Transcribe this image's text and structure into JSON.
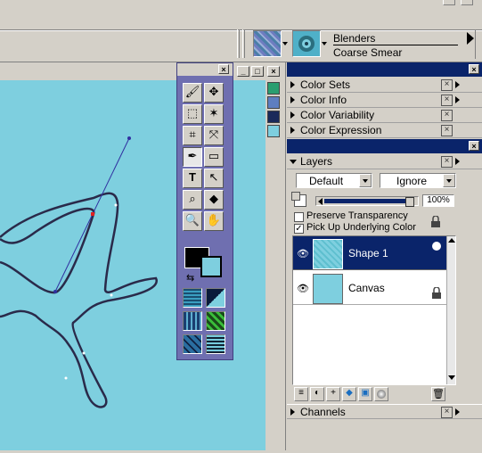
{
  "brush": {
    "category": "Blenders",
    "variant": "Coarse Smear"
  },
  "window_controls": {
    "close": "×",
    "minimize": "_",
    "maximize": "□"
  },
  "palette_sections": [
    {
      "label": "Color Sets"
    },
    {
      "label": "Color Info"
    },
    {
      "label": "Color Variability"
    },
    {
      "label": "Color Expression"
    }
  ],
  "layers_panel": {
    "title": "Layers",
    "composite_method": "Default",
    "composite_depth": "Ignore",
    "opacity": "100%",
    "opacity_value": 1.0,
    "preserve_transparency_label": "Preserve Transparency",
    "preserve_transparency_checked": false,
    "pick_up_color_label": "Pick Up Underlying Color",
    "pick_up_color_checked": true,
    "layers": [
      {
        "name": "Shape 1",
        "selected": true
      },
      {
        "name": "Canvas",
        "selected": false
      }
    ]
  },
  "channels_panel": {
    "title": "Channels"
  },
  "colors": {
    "canvas": "#7ecfdf",
    "title_bar": "#0a246a",
    "toolbox": "#6f6fb0",
    "selection": "#0a246a",
    "path": "#2a2a4a",
    "secondary_color": "#7ecfdf",
    "primary_color": "#000000"
  },
  "tools": [
    {
      "icon": "brush-icon",
      "glyph": "🖌"
    },
    {
      "icon": "layer-adjuster-icon",
      "glyph": "✥"
    },
    {
      "icon": "rect-selection-icon",
      "glyph": "⬚"
    },
    {
      "icon": "magic-wand-icon",
      "glyph": "✶"
    },
    {
      "icon": "crop-icon",
      "glyph": "⌗"
    },
    {
      "icon": "lasso-icon",
      "glyph": "⤧"
    },
    {
      "icon": "pen-icon",
      "glyph": "✒"
    },
    {
      "icon": "rectangle-shape-icon",
      "glyph": "▭"
    },
    {
      "icon": "text-icon",
      "glyph": "T"
    },
    {
      "icon": "shape-selection-icon",
      "glyph": "↖"
    },
    {
      "icon": "dropper-icon",
      "glyph": "⌕"
    },
    {
      "icon": "paint-bucket-icon",
      "glyph": "◆"
    },
    {
      "icon": "magnifier-icon",
      "glyph": "🔍"
    },
    {
      "icon": "grabber-hand-icon",
      "glyph": "✋"
    }
  ]
}
